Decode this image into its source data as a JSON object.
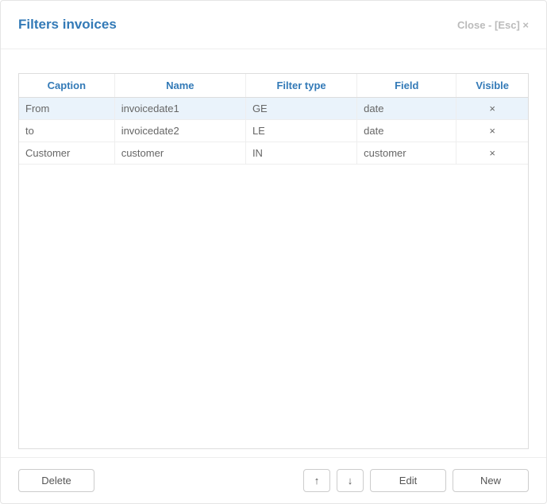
{
  "dialog": {
    "title": "Filters invoices",
    "close_label": "Close - [Esc] ×"
  },
  "table": {
    "columns": {
      "caption": "Caption",
      "name": "Name",
      "filter_type": "Filter type",
      "field": "Field",
      "visible": "Visible"
    },
    "rows": [
      {
        "caption": "From",
        "name": "invoicedate1",
        "filter_type": "GE",
        "field": "date",
        "visible": "×",
        "selected": true
      },
      {
        "caption": "to",
        "name": "invoicedate2",
        "filter_type": "LE",
        "field": "date",
        "visible": "×",
        "selected": false
      },
      {
        "caption": "Customer",
        "name": "customer",
        "filter_type": "IN",
        "field": "customer",
        "visible": "×",
        "selected": false
      }
    ]
  },
  "footer": {
    "delete_label": "Delete",
    "up_glyph": "↑",
    "down_glyph": "↓",
    "edit_label": "Edit",
    "new_label": "New"
  }
}
